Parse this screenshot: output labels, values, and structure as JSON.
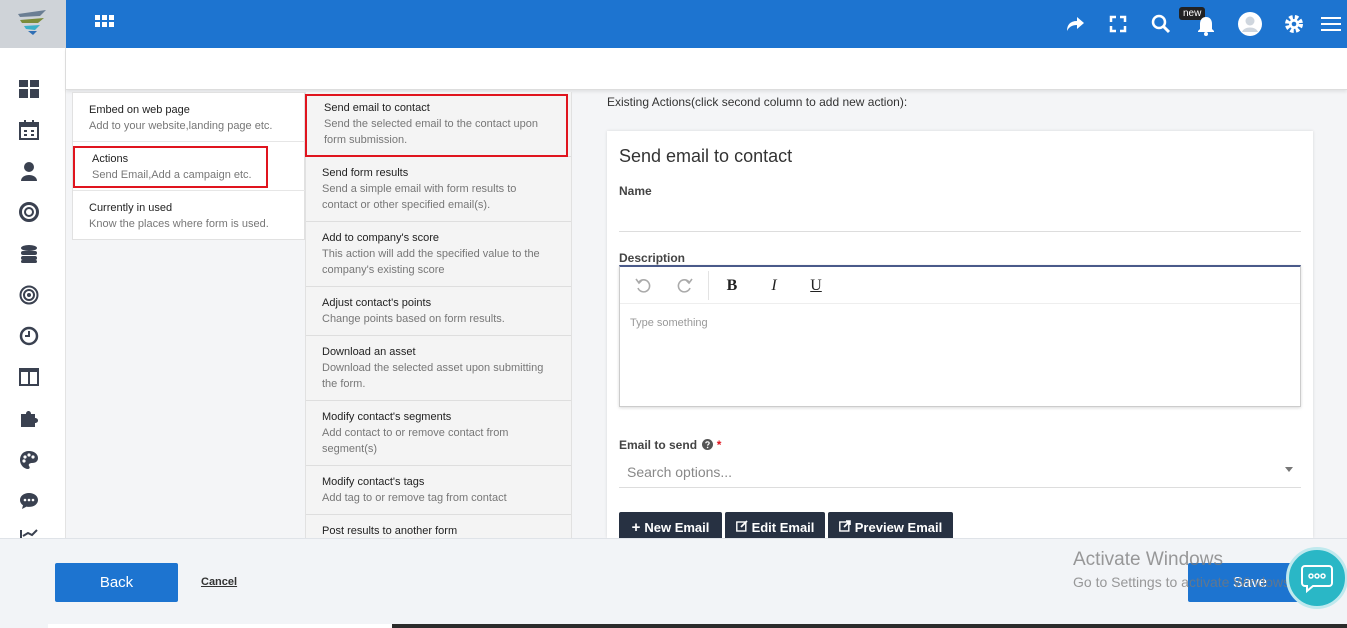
{
  "topbar": {
    "new_badge": "new",
    "icons": [
      "app-grid-icon",
      "share-icon",
      "fullscreen-icon",
      "search-icon",
      "bell-icon",
      "avatar",
      "gear-icon",
      "menu-icon"
    ]
  },
  "sidebar": {
    "icons": [
      "dashboard-icon",
      "calendar-icon",
      "user-icon",
      "lifebuoy-icon",
      "database-icon",
      "target-icon",
      "clock-icon",
      "columns-icon",
      "puzzle-icon",
      "palette-icon",
      "chat-icon",
      "chart-icon"
    ]
  },
  "col1": {
    "items": [
      {
        "title": "Embed on web page",
        "desc": "Add to your website,landing page etc."
      },
      {
        "title": "Actions",
        "desc": "Send Email,Add a campaign etc."
      },
      {
        "title": "Currently in used",
        "desc": "Know the places where form is used."
      }
    ]
  },
  "col2": {
    "items": [
      {
        "title": "Send email to contact",
        "desc1": "Send the selected email to the contact upon",
        "desc2": "form submission."
      },
      {
        "title": "Send form results",
        "desc1": "Send a simple email with form results to",
        "desc2": "contact or other specified email(s)."
      },
      {
        "title": "Add to company's score",
        "desc1": "This action will add the specified value to the",
        "desc2": "company's existing score"
      },
      {
        "title": "Adjust contact's points",
        "desc1": "Change points based on form results.",
        "desc2": ""
      },
      {
        "title": "Download an asset",
        "desc1": "Download the selected asset upon submitting",
        "desc2": "the form."
      },
      {
        "title": "Modify contact's segments",
        "desc1": "Add contact to or remove contact from",
        "desc2": "segment(s)"
      },
      {
        "title": "Modify contact's tags",
        "desc1": "Add tag to or remove tag from contact",
        "desc2": ""
      },
      {
        "title": "Post results to another form",
        "desc1": "",
        "desc2": ""
      }
    ]
  },
  "panel": {
    "existing_label": "Existing Actions(click second column to add new action):",
    "card_title": "Send email to contact",
    "name_label": "Name",
    "description_label": "Description",
    "editor_placeholder": "Type something",
    "editor_buttons": {
      "bold": "B",
      "italic": "I",
      "underline": "U"
    },
    "email_label": "Email to send",
    "required_mark": "*",
    "search_placeholder": "Search options...",
    "buttons": {
      "new_email": "New Email",
      "edit_email": "Edit Email",
      "preview_email": "Preview Email"
    }
  },
  "footer": {
    "back": "Back",
    "cancel": "Cancel",
    "save": "Save",
    "activate_title": "Activate Windows",
    "activate_sub": "Go to Settings to activate Windows."
  },
  "colors": {
    "primary": "#1d74d0",
    "dark_button": "#273142",
    "highlight": "#e0141e",
    "chat": "#2ab7c6"
  }
}
